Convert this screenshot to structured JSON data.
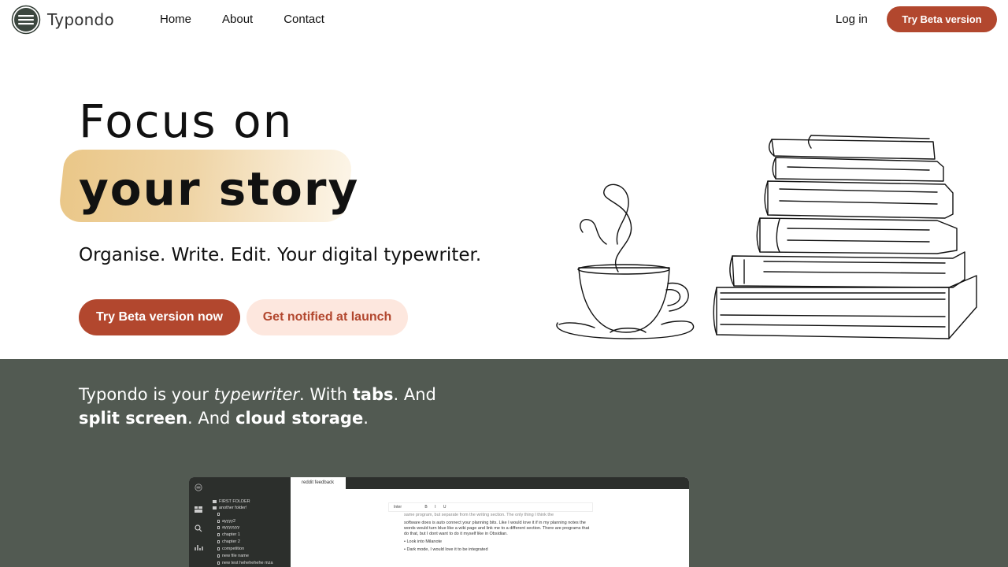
{
  "nav": {
    "brand": "Typondo",
    "links": [
      {
        "label": "Home"
      },
      {
        "label": "About"
      },
      {
        "label": "Contact"
      }
    ],
    "login": "Log in",
    "cta": "Try Beta version"
  },
  "hero": {
    "line1": "Focus on",
    "line2": "your story",
    "subtitle": "Organise. Write. Edit. Your digital typewriter.",
    "primary_button": "Try Beta version now",
    "secondary_button": "Get notified at launch"
  },
  "features": {
    "t1": "Typondo is your ",
    "t2": "typewriter",
    "t3": ". With ",
    "t4": "tabs",
    "t5": ". And ",
    "t6": "split screen",
    "t7": ". And ",
    "t8": "cloud storage",
    "t9": "."
  },
  "app_preview": {
    "tab": "reddit feedback",
    "toolbar": {
      "font": "Inter",
      "bold": "B",
      "italic": "I",
      "underline": "U"
    },
    "sidebar": [
      {
        "label": "FIRST FOLDER",
        "kind": "folder"
      },
      {
        "label": "another folder!",
        "kind": "folder"
      },
      {
        "label": "",
        "kind": "file"
      },
      {
        "label": "ayyyy2",
        "kind": "file"
      },
      {
        "label": "ayyyyyyy",
        "kind": "file"
      },
      {
        "label": "chapter 1",
        "kind": "file"
      },
      {
        "label": "chapter 2",
        "kind": "file"
      },
      {
        "label": "competition",
        "kind": "file"
      },
      {
        "label": "new file name",
        "kind": "file"
      },
      {
        "label": "new test hehehehehe mza",
        "kind": "file"
      }
    ],
    "editor": {
      "para1": "same program, but separate from the writing section. The only thing I think the",
      "para2": "software does is auto connect your planning bits. Like I would love it if in my planning notes the words would turn blue like a wiki page and link me to a different section. There are programs that do that, but I dont want to do it myself like in Obsidian.",
      "bullet1": "Look into Milanote",
      "bullet2": "Dark mode, I would love it to be integrated"
    }
  },
  "colors": {
    "accent": "#b2472e",
    "accent_light": "#fde7de",
    "dark_section": "#525a52",
    "highlight": "#e9c482"
  }
}
